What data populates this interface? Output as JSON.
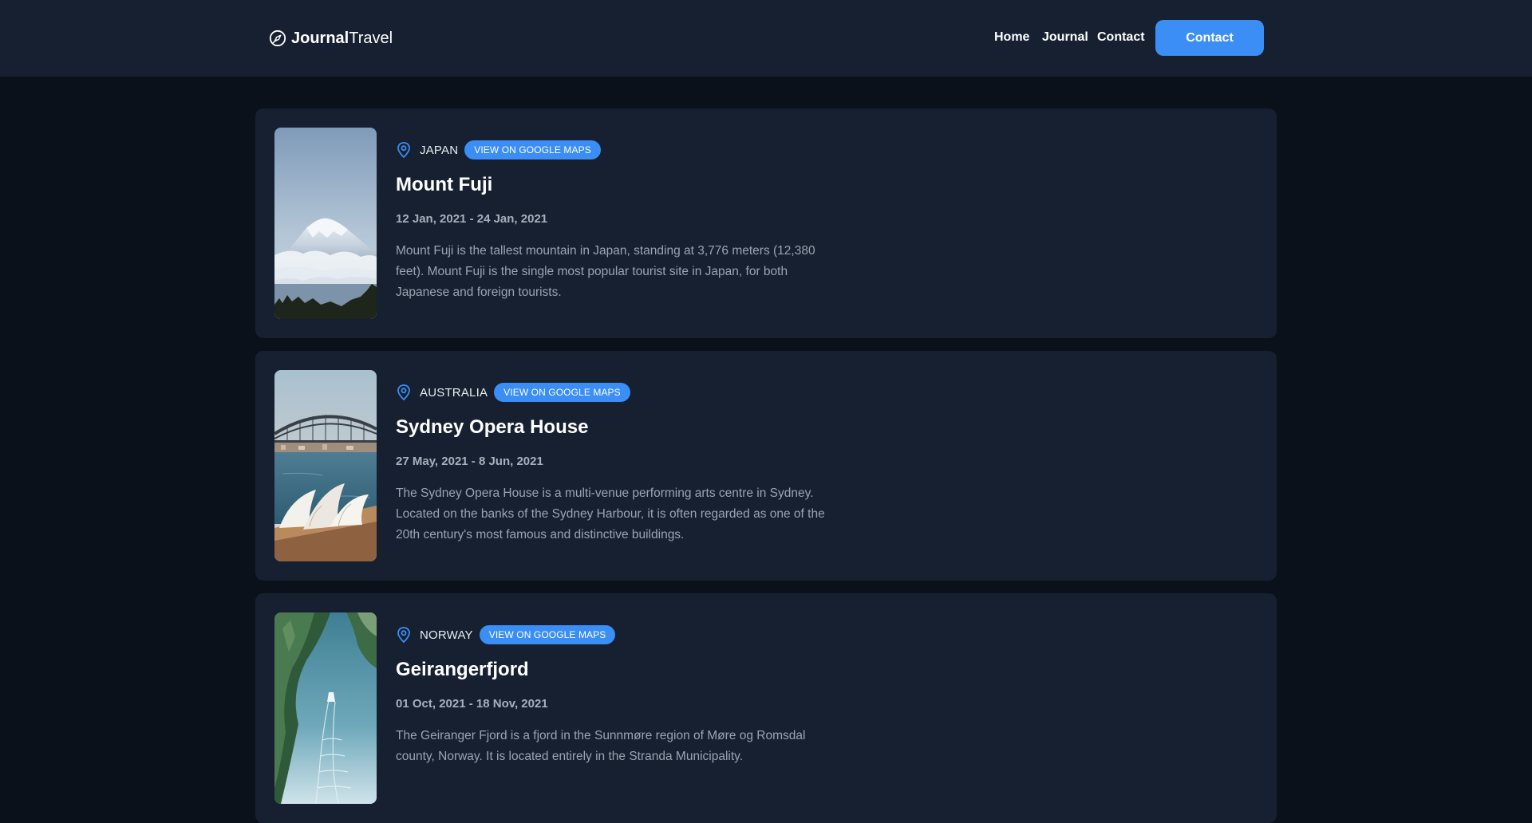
{
  "brand": {
    "name_bold": "Journal",
    "name_light": "Travel",
    "icon": "compass-icon"
  },
  "nav": {
    "links": [
      "Home",
      "Journal",
      "Contact"
    ],
    "cta_label": "Contact"
  },
  "colors": {
    "accent": "#3b8ef5",
    "page_background": "#0b111a",
    "card_background": "#162030"
  },
  "entries": [
    {
      "country": "JAPAN",
      "maps_label": "VIEW ON GOOGLE MAPS",
      "title": "Mount Fuji",
      "dates": "12 Jan, 2021 - 24 Jan, 2021",
      "description": "Mount Fuji is the tallest mountain in Japan, standing at 3,776 meters (12,380 feet). Mount Fuji is the single most popular tourist site in Japan, for both Japanese and foreign tourists.",
      "image": "mount-fuji-photo"
    },
    {
      "country": "AUSTRALIA",
      "maps_label": "VIEW ON GOOGLE MAPS",
      "title": "Sydney Opera House",
      "dates": "27 May, 2021 - 8 Jun, 2021",
      "description": "The Sydney Opera House is a multi-venue performing arts centre in Sydney. Located on the banks of the Sydney Harbour, it is often regarded as one of the 20th century's most famous and distinctive buildings.",
      "image": "sydney-opera-house-photo"
    },
    {
      "country": "NORWAY",
      "maps_label": "VIEW ON GOOGLE MAPS",
      "title": "Geirangerfjord",
      "dates": "01 Oct, 2021 - 18 Nov, 2021",
      "description": "The Geiranger Fjord is a fjord in the Sunnmøre region of Møre og Romsdal county, Norway. It is located entirely in the Stranda Municipality.",
      "image": "geirangerfjord-photo"
    }
  ]
}
